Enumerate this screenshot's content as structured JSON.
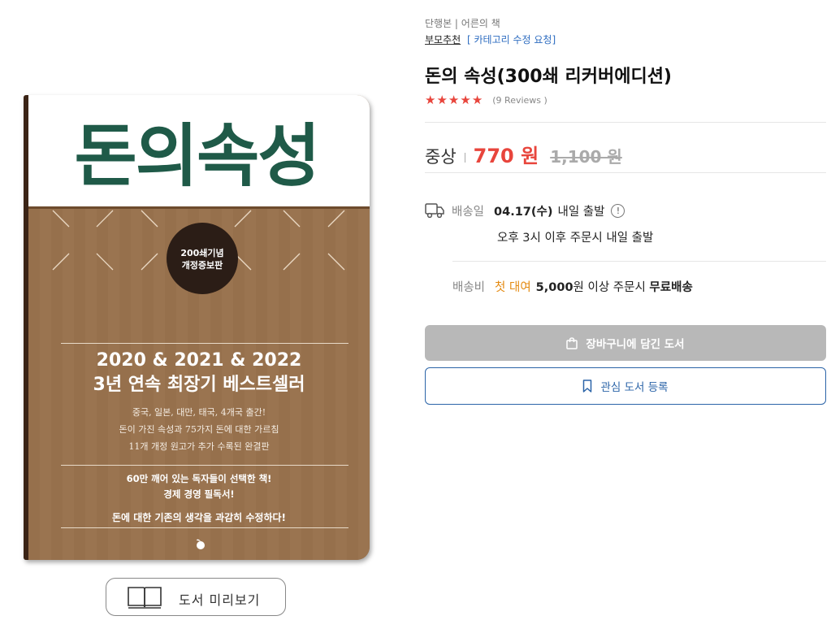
{
  "book": {
    "format_line": "단행본 | 어른의 책",
    "category": {
      "main": "부모추천",
      "edit_link": "[ 카테고리 수정 요청]"
    },
    "title": "돈의 속성(300쇄 리커버에디션)",
    "rating": {
      "stars": 5,
      "reviews_text": "(9 Reviews )"
    }
  },
  "cover": {
    "title": "돈의속성",
    "badge_line1": "200쇄기념",
    "badge_line2": "개정증보판",
    "main_line1": "2020 & 2021 & 2022",
    "main_line2": "3년 연속 최장기 베스트셀러",
    "sub_line1": "중국, 일본, 대만, 태국, 4개국 출간!",
    "sub_line2": "돈이 가진 속성과 75가지 돈에 대한 가르침",
    "sub_line3": "11개 개정 원고가 추가 수록된 완결판",
    "quote_line1": "60만 깨어 있는 독자들이 선택한 책!",
    "quote_line2": "경제 경영 필독서!",
    "quote_line3": "돈에 대한 기존의 생각을 과감히 수정하다!"
  },
  "preview": {
    "label": "도서 미리보기"
  },
  "price": {
    "condition": "중상",
    "sale": "770 원",
    "original": "1,100 원"
  },
  "shipping": {
    "label": "배송일",
    "date": "04.17(수)",
    "status": "내일 출발",
    "info_icon": "!",
    "note": "오후 3시 이후 주문시 내일 출발",
    "fee_label": "배송비",
    "fee_highlight": "첫 대여",
    "fee_amount": "5,000",
    "fee_text": "원 이상 주문시",
    "fee_free": "무료배송"
  },
  "buttons": {
    "cart": "장바구니에 담긴 도서",
    "wish": "관심 도서 등록"
  },
  "colors": {
    "accent_red": "#e8453c",
    "fee_orange": "#e48a11",
    "link_blue": "#2b64a8",
    "cover_brown": "#96704c",
    "cover_green": "#1f5a48"
  }
}
